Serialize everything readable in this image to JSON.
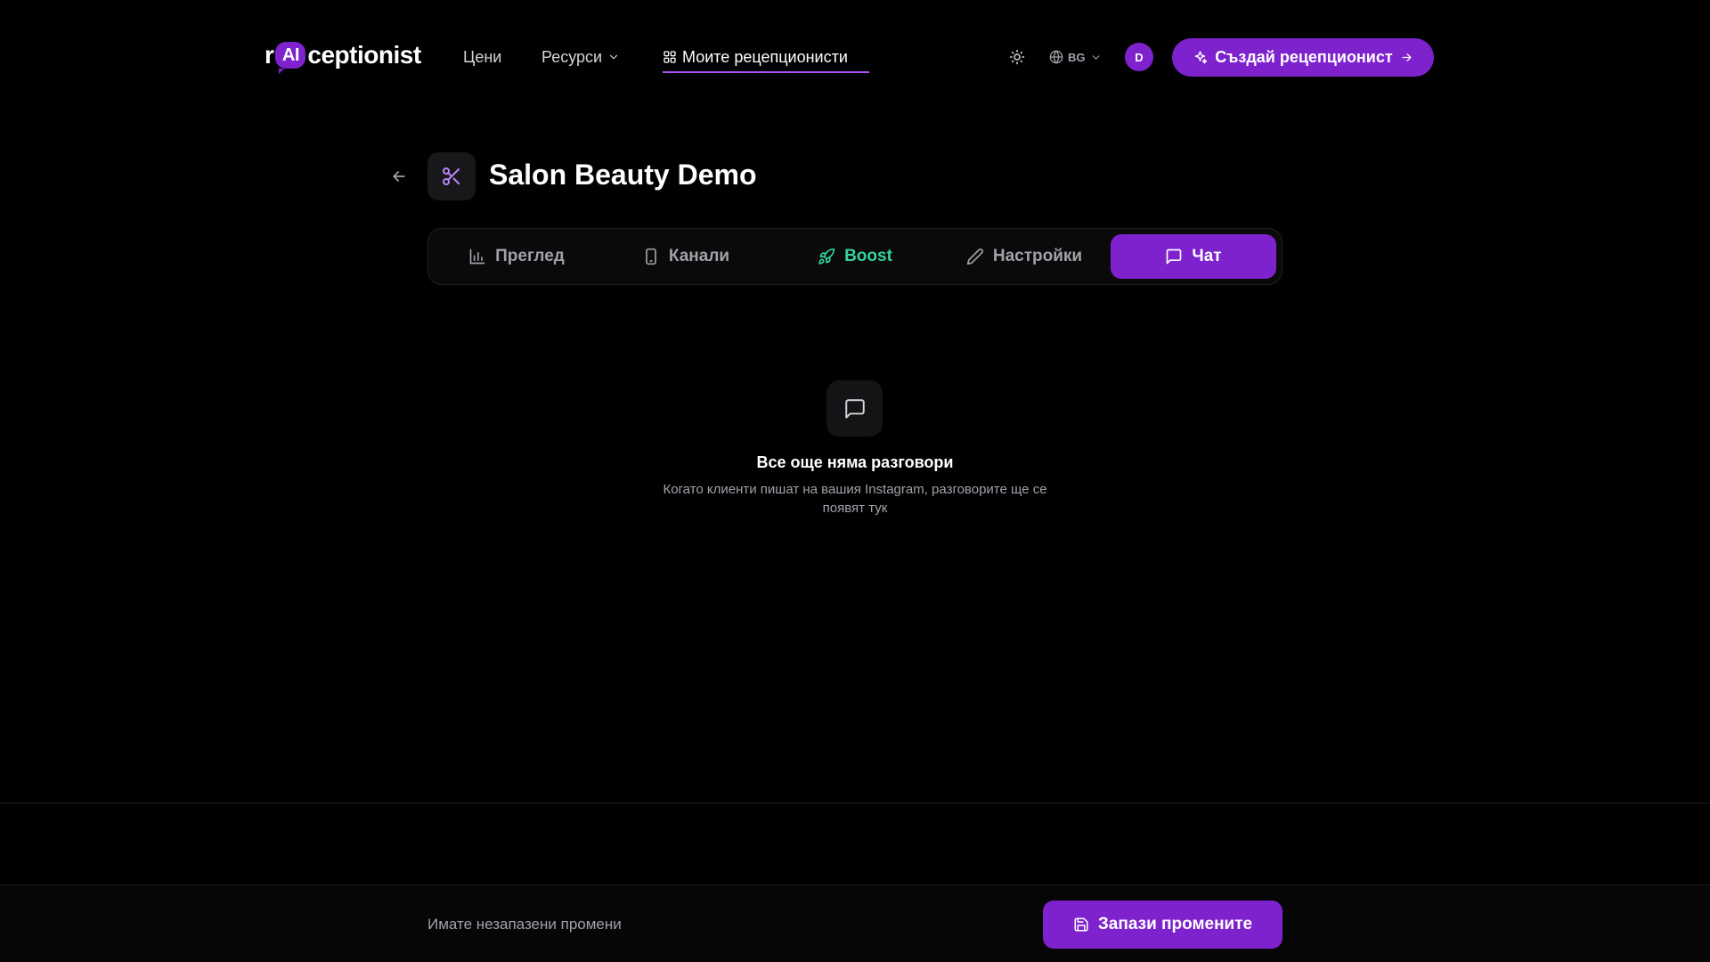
{
  "header": {
    "logo": {
      "prefix": "r",
      "badge": "AI",
      "suffix": "ceptionist"
    },
    "nav": {
      "pricing": "Цени",
      "resources": "Ресурси",
      "my_receptionists": "Моите рецепционисти"
    },
    "language": "BG",
    "avatar_initial": "D",
    "cta_label": "Създай рецепционист"
  },
  "page": {
    "title": "Salon Beauty Demo"
  },
  "tabs": [
    {
      "label": "Преглед",
      "icon": "bar-chart-icon"
    },
    {
      "label": "Канали",
      "icon": "phone-icon"
    },
    {
      "label": "Boost",
      "icon": "rocket-icon"
    },
    {
      "label": "Настройки",
      "icon": "pencil-icon"
    },
    {
      "label": "Чат",
      "icon": "chat-icon",
      "active": true
    }
  ],
  "empty_state": {
    "title": "Все още няма разговори",
    "description": "Когато клиенти пишат на вашия Instagram, разговорите ще се появят тук"
  },
  "save_bar": {
    "message": "Имате незапазени промени",
    "save_label": "Запази промените"
  },
  "colors": {
    "accent": "#7e22ce",
    "boost": "#34d399",
    "background": "#000000"
  }
}
